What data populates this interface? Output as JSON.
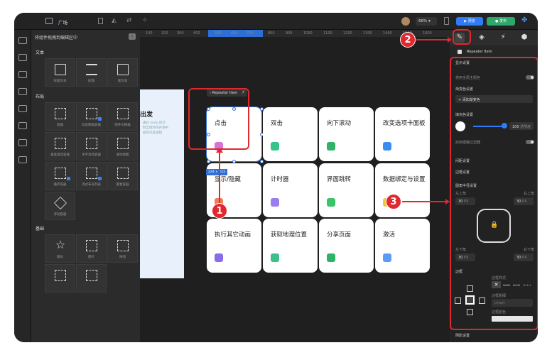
{
  "window": {
    "title": "广场"
  },
  "topbar": {
    "zoom": "66%",
    "preview_label": "预览",
    "publish_label": "发布"
  },
  "left_panel": {
    "header": "将组件拖拽到编辑区中",
    "sections": [
      {
        "title": "文本",
        "items": [
          "标题文本",
          "段落",
          "富文本"
        ]
      },
      {
        "title": "布局",
        "items": [
          "容器",
          "动态数据容器",
          "组件切换器",
          "垂直滚动容器",
          "水平滚动容器",
          "滚动视图",
          "循环容器",
          "流式布局列表",
          "重复容器",
          "浮动容器"
        ]
      },
      {
        "title": "基础",
        "items": [
          "图标",
          "图片",
          "按钮"
        ]
      }
    ]
  },
  "ruler": {
    "ticks": [
      "100",
      "200",
      "300",
      "400",
      "500",
      "600",
      "700",
      "800",
      "900",
      "1000",
      "1100",
      "1200",
      "1300",
      "1400",
      "1500",
      "1600"
    ]
  },
  "artboard": {
    "title": "出发",
    "desc": "通过 ioafy 的交\n制全提到作开发中\n据的流处逻辑"
  },
  "canvas": {
    "breadcrumb": "Repeater Item",
    "size_badge": "224 × 223",
    "cards": [
      {
        "label": "点击",
        "color": "#d872d8"
      },
      {
        "label": "双击",
        "color": "#36c48a"
      },
      {
        "label": "向下滚动",
        "color": "#2fb368"
      },
      {
        "label": "改变选项卡面板",
        "color": "#3a8cf0"
      },
      {
        "label": "显示/隐藏",
        "color": "#f07c5a"
      },
      {
        "label": "计时器",
        "color": "#9a7ef0"
      },
      {
        "label": "界面跳转",
        "color": "#3cc46a"
      },
      {
        "label": "数据绑定与设置",
        "color": "#f5c542"
      },
      {
        "label": "执行其它动画",
        "color": "#8a6ee8"
      },
      {
        "label": "获取地理位置",
        "color": "#3dbf8a"
      },
      {
        "label": "分享页面",
        "color": "#2fb368"
      },
      {
        "label": "激活",
        "color": "#5a9cf5"
      }
    ]
  },
  "right_panel": {
    "header": "Repeater Item",
    "display_settings": "显示设置",
    "use_global_theme": "使用全局主题色",
    "gradient_setting": "渐变色设置",
    "add_gradient": "添加渐变色",
    "fill_setting": "填充色设置",
    "opacity_value": "100",
    "opacity_unit": "透明度",
    "blur_filter": "启用模糊过滤器",
    "spacing_setting": "间距设置",
    "border_setting": "边框设置",
    "corner_radius": "圆角半径设置",
    "top_left": "左上角",
    "top_right": "右上角",
    "bottom_left": "左下角",
    "bottom_right": "右下角",
    "radius_value": "30",
    "unit": "PX",
    "border": "边框",
    "border_style": "边框样式",
    "border_width": "边框粗细",
    "unset": "Unset",
    "border_color": "边框颜色",
    "shadow_setting": "阴影设置"
  },
  "annotations": {
    "one": "1",
    "two": "2",
    "three": "3"
  }
}
